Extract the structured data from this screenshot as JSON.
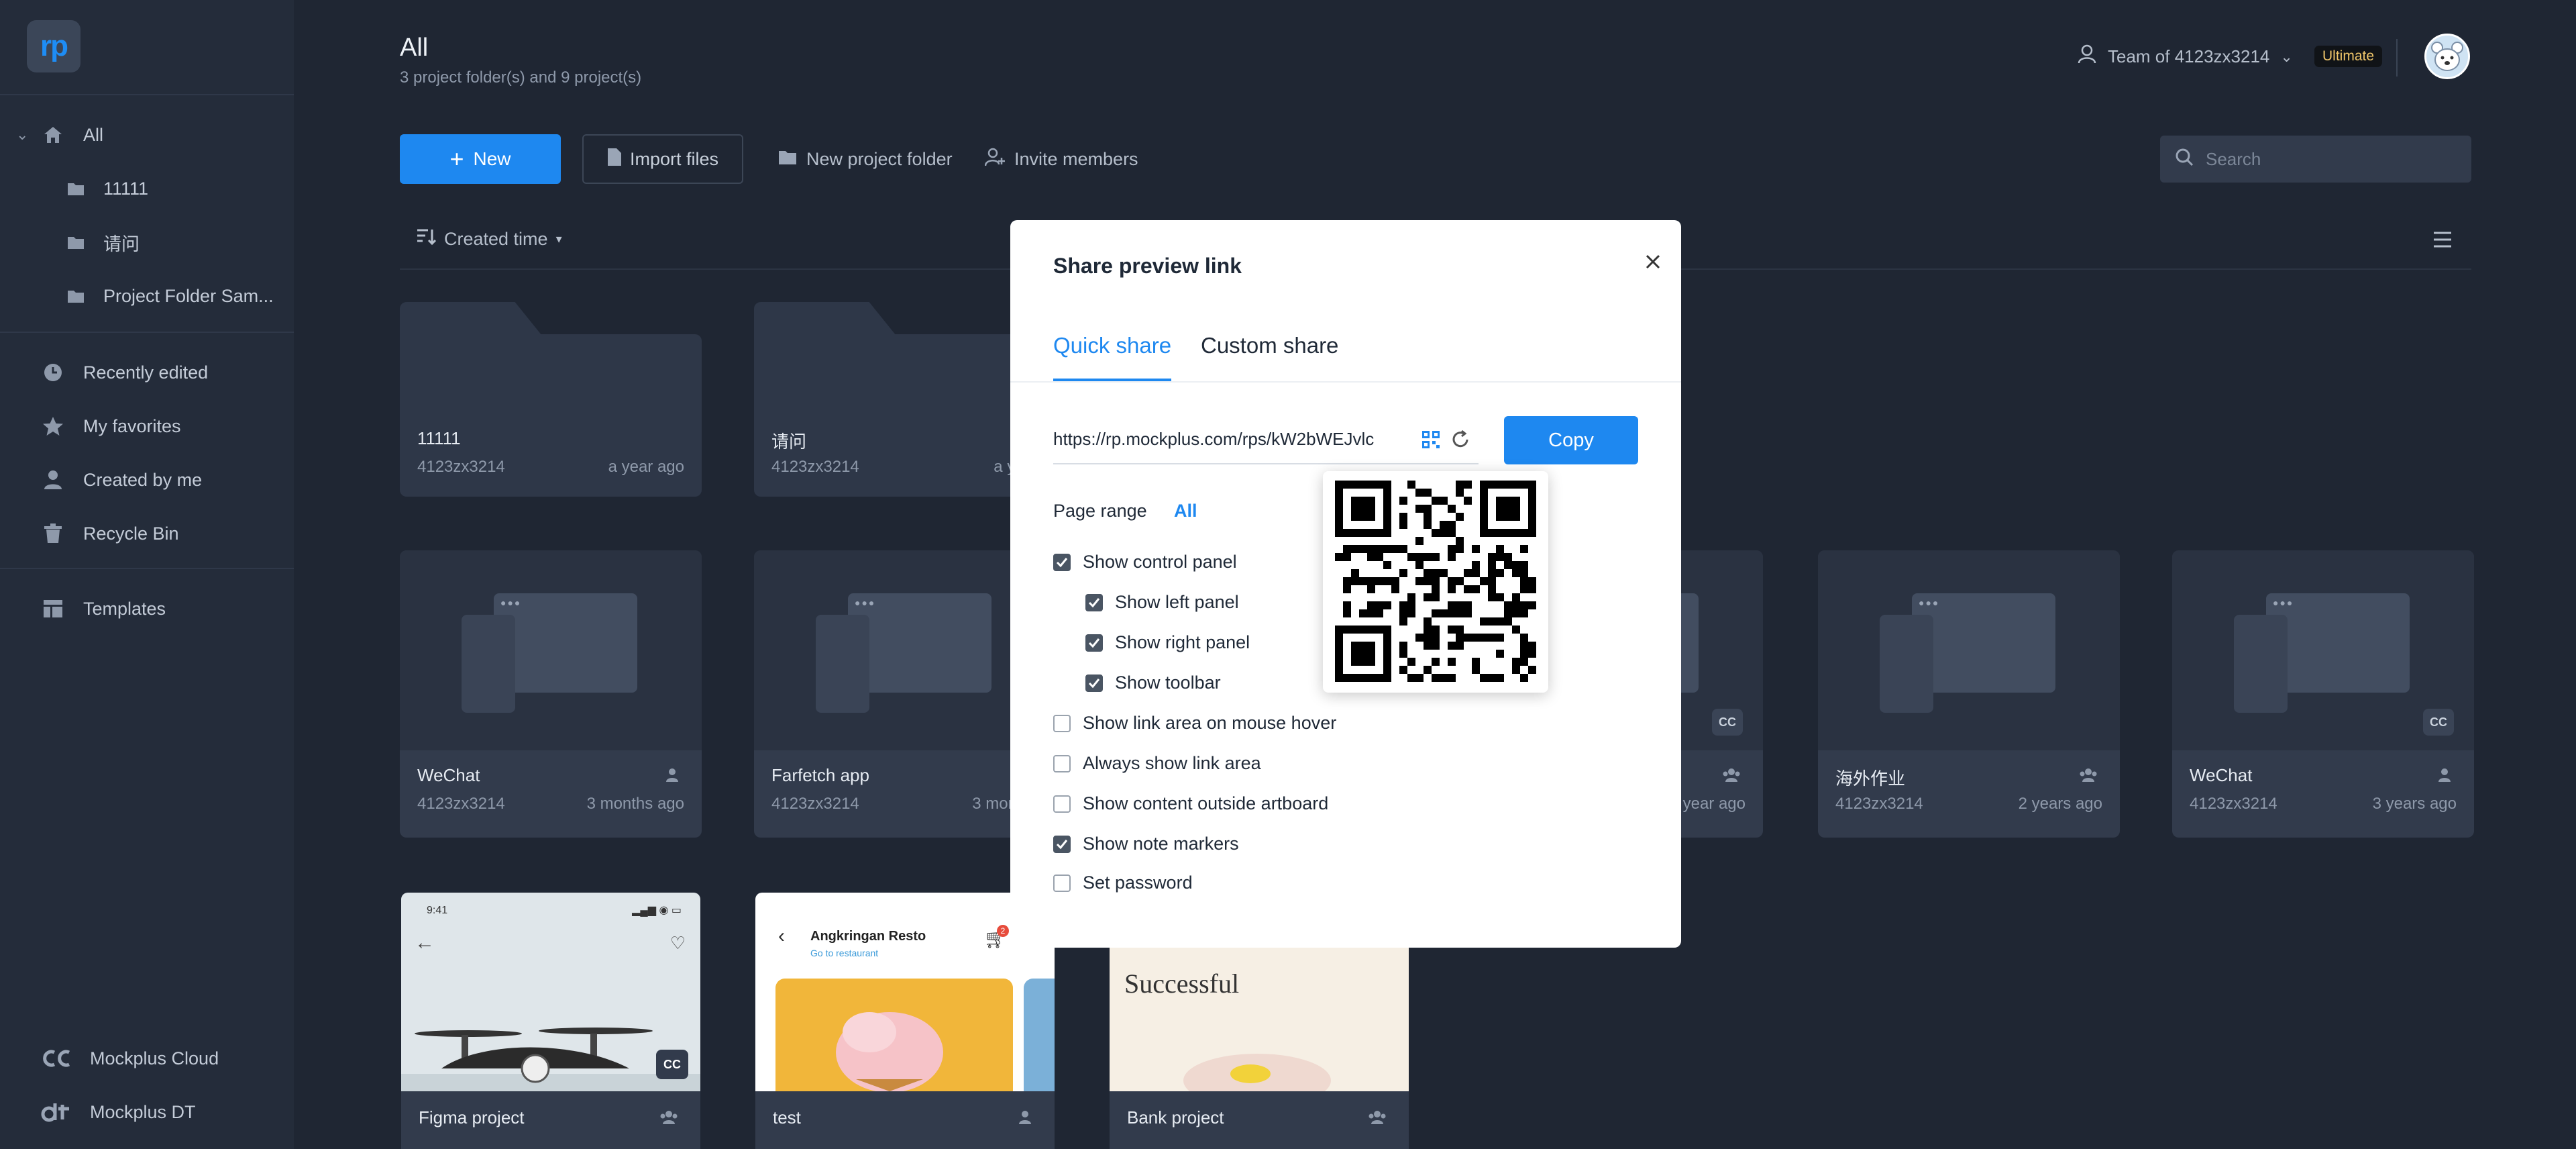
{
  "sidebar": {
    "logo_text": "rp",
    "root_label": "All",
    "folders": [
      {
        "label": "11111"
      },
      {
        "label": "请问"
      },
      {
        "label": "Project Folder Sam..."
      }
    ],
    "nav": [
      {
        "label": "Recently edited",
        "icon": "clock-icon"
      },
      {
        "label": "My favorites",
        "icon": "star-icon"
      },
      {
        "label": "Created by me",
        "icon": "person-icon"
      },
      {
        "label": "Recycle Bin",
        "icon": "trash-icon"
      }
    ],
    "templates_label": "Templates",
    "footer": [
      {
        "label": "Mockplus Cloud",
        "icon": "mockplus-cloud-icon"
      },
      {
        "label": "Mockplus DT",
        "icon": "mockplus-dt-icon"
      }
    ]
  },
  "header": {
    "title": "All",
    "subtitle": "3 project folder(s) and 9 project(s)",
    "team_label": "Team of 4123zx3214",
    "plan_badge": "Ultimate"
  },
  "toolbar": {
    "new_label": "New",
    "import_label": "Import files",
    "new_folder_label": "New project folder",
    "invite_label": "Invite members",
    "search_placeholder": "Search",
    "sort_label": "Created time"
  },
  "folder_cards": [
    {
      "name": "11111",
      "owner": "4123zx3214",
      "time": "a year ago"
    },
    {
      "name": "请问",
      "owner": "4123zx3214",
      "time": "a year"
    }
  ],
  "project_cards": [
    {
      "name": "WeChat",
      "owner": "4123zx3214",
      "time": "3 months ago",
      "badge": ""
    },
    {
      "name": "Farfetch app",
      "owner": "4123zx3214",
      "time": "3 months",
      "badge": ""
    },
    {
      "name": "",
      "owner": "",
      "time": "year ago",
      "badge": "CC"
    },
    {
      "name": "海外作业",
      "owner": "4123zx3214",
      "time": "2 years ago",
      "badge": ""
    },
    {
      "name": "WeChat",
      "owner": "4123zx3214",
      "time": "3 years ago",
      "badge": "CC"
    }
  ],
  "bottom_cards": [
    {
      "name": "Figma project",
      "status_time": "9:41",
      "badge": "CC"
    },
    {
      "name": "test",
      "app_title": "Angkringan Resto",
      "app_sub": "Go to restaurant",
      "cart_count": "2"
    },
    {
      "name": "Bank project",
      "headline": "Successful"
    }
  ],
  "modal": {
    "title": "Share preview link",
    "tabs": [
      "Quick share",
      "Custom share"
    ],
    "link": "https://rp.mockplus.com/rps/kW2bWEJvlc",
    "copy_label": "Copy",
    "page_range_label": "Page range",
    "page_range_value": "All",
    "options": [
      {
        "label": "Show control panel",
        "checked": true
      },
      {
        "label": "Show left panel",
        "checked": true
      },
      {
        "label": "Show right panel",
        "checked": true
      },
      {
        "label": "Show toolbar",
        "checked": true
      },
      {
        "label": "Show link area on mouse hover",
        "checked": false
      },
      {
        "label": "Always show link area",
        "checked": false
      },
      {
        "label": "Show content outside artboard",
        "checked": false
      },
      {
        "label": "Show note markers",
        "checked": true
      },
      {
        "label": "Set password",
        "checked": false
      }
    ]
  },
  "colors": {
    "accent": "#1e88f0",
    "background": "#1f2633",
    "sidebar": "#242c3a",
    "card": "#323b4c",
    "badge_text": "#f0c66a"
  }
}
